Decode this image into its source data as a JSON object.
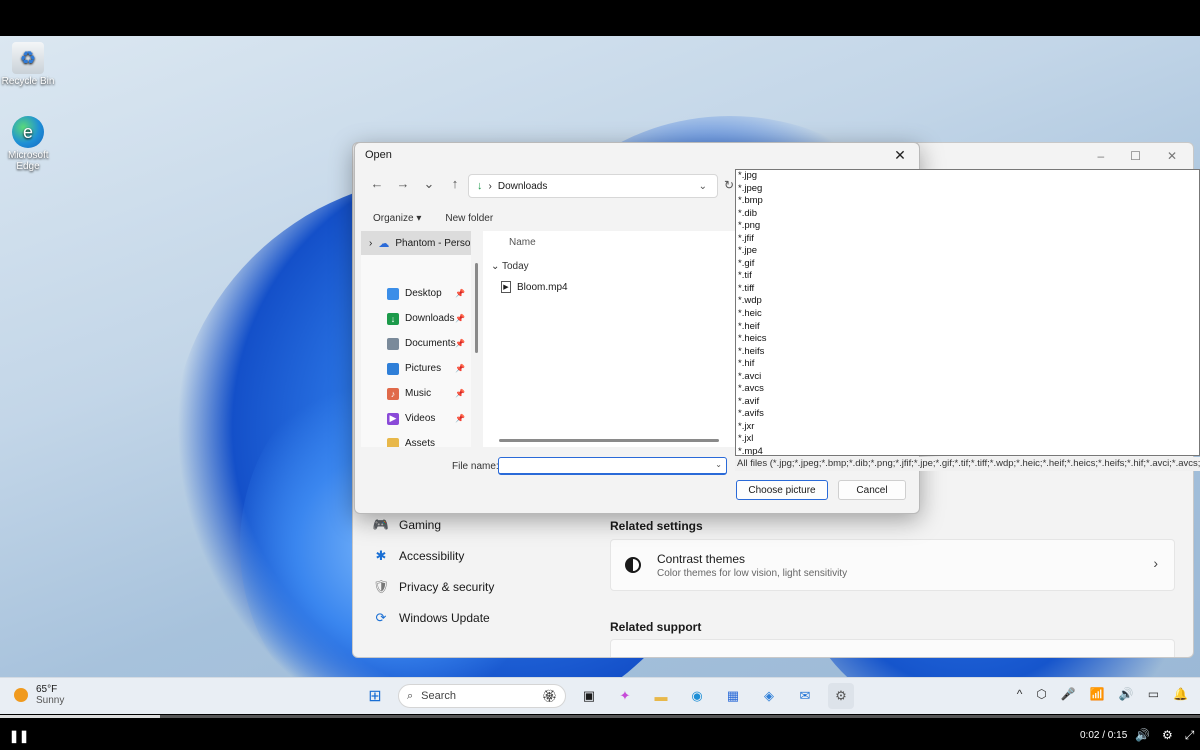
{
  "desktop": {
    "icons": [
      {
        "label": "Recycle Bin",
        "glyph": "♻"
      },
      {
        "label": "Microsoft Edge",
        "glyph": "e"
      }
    ]
  },
  "settings": {
    "nav": [
      {
        "label": "Gaming",
        "icon": "gamepad-icon",
        "glyph": "🎮"
      },
      {
        "label": "Accessibility",
        "icon": "accessibility-icon",
        "glyph": "✱"
      },
      {
        "label": "Privacy & security",
        "icon": "shield-icon",
        "glyph": "🛡"
      },
      {
        "label": "Windows Update",
        "icon": "update-icon",
        "glyph": "⟳"
      }
    ],
    "related_settings_title": "Related settings",
    "contrast_card": {
      "title": "Contrast themes",
      "subtitle": "Color themes for low vision, light sensitivity"
    },
    "related_support_title": "Related support",
    "window_controls": [
      "–",
      "☐",
      "✕"
    ]
  },
  "dialog": {
    "title": "Open",
    "close": "✕",
    "nav": [
      "←",
      "→",
      "⌄",
      "↑"
    ],
    "address": {
      "separator": "›",
      "folder": "Downloads",
      "chevron": "⌄"
    },
    "refresh": "↻",
    "toolbar": {
      "organize": "Organize ▾",
      "new_folder": "New folder"
    },
    "tree_top": {
      "chevron": "›",
      "label": "Phantom - Perso"
    },
    "quick_access": [
      {
        "label": "Desktop",
        "color": "#3b8ee8",
        "glyph": ""
      },
      {
        "label": "Downloads",
        "color": "#1c9a4a",
        "glyph": "↓"
      },
      {
        "label": "Documents",
        "color": "#7a8a9a",
        "glyph": ""
      },
      {
        "label": "Pictures",
        "color": "#2f7fd8",
        "glyph": ""
      },
      {
        "label": "Music",
        "color": "#e06a4a",
        "glyph": "♪"
      },
      {
        "label": "Videos",
        "color": "#8a4ad8",
        "glyph": "▶"
      },
      {
        "label": "Assets",
        "color": "#e8b84a",
        "glyph": ""
      }
    ],
    "pin": "📌",
    "column_name": "Name",
    "group": "Today",
    "group_chevron": "⌄",
    "file": "Bloom.mp4",
    "file_name_label": "File name:",
    "file_name_value": "",
    "file_name_dropdown": "⌄",
    "choose_button": "Choose picture",
    "cancel_button": "Cancel"
  },
  "file_types": {
    "options": [
      "*.jpg",
      "*.jpeg",
      "*.bmp",
      "*.dib",
      "*.png",
      "*.jfif",
      "*.jpe",
      "*.gif",
      "*.tif",
      "*.tiff",
      "*.wdp",
      "*.heic",
      "*.heif",
      "*.heics",
      "*.heifs",
      "*.hif",
      "*.avci",
      "*.avcs",
      "*.avif",
      "*.avifs",
      "*.jxr",
      "*.jxl",
      "*.mp4"
    ],
    "current": "All files (*.jpg;*.jpeg;*.bmp;*.dib;*.png;*.jfif;*.jpe;*.gif;*.tif;*.tiff;*.wdp;*.heic;*.heif;*.heics;*.heifs;*.hif;*.avci;*.avcs;*.av"
  },
  "taskbar": {
    "weather": {
      "temp": "65°F",
      "condition": "Sunny"
    },
    "search_placeholder": "Search",
    "apps": [
      "start",
      "search",
      "task-view",
      "copilot",
      "file-explorer",
      "edge",
      "store",
      "photos",
      "outlook",
      "settings"
    ],
    "tray": [
      "^",
      "⬡",
      "🎤",
      "📶",
      "🔊",
      "▭",
      "🔔"
    ]
  },
  "player": {
    "play_glyph": "❚❚",
    "time": "0:02 / 0:15",
    "progress": 0.1333,
    "icons": [
      "🔊",
      "⚙",
      "⤢"
    ]
  }
}
